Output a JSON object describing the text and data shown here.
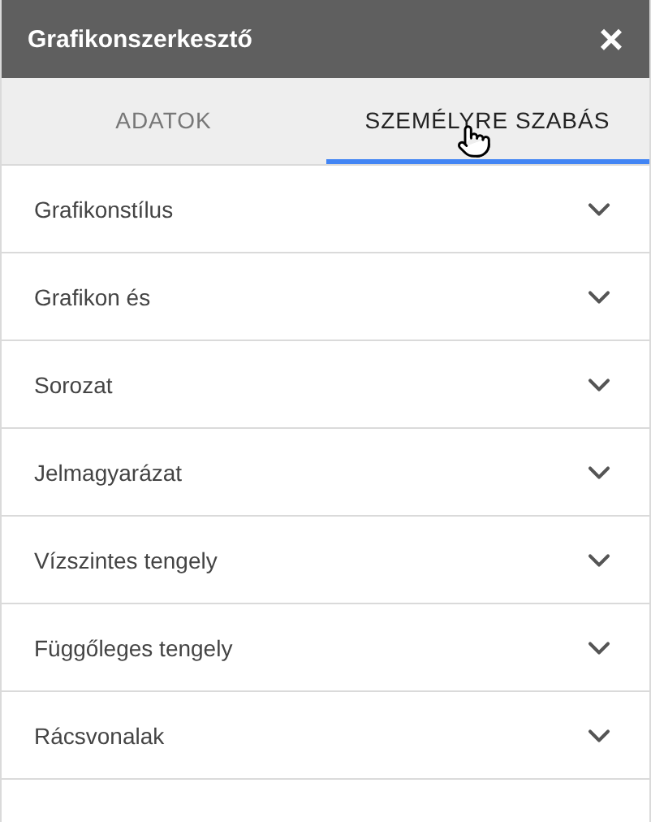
{
  "window": {
    "title": "Grafikonszerkesztő",
    "close": "×"
  },
  "tabs": [
    {
      "label": "ADATOK",
      "selected": false
    },
    {
      "label": "SZEMÉLYRE SZABÁS",
      "selected": true
    }
  ],
  "sections": [
    {
      "label": "Grafikonstílus",
      "expanded": false
    },
    {
      "label": "Grafikon és",
      "expanded": false
    },
    {
      "label": "Sorozat",
      "expanded": false
    },
    {
      "label": "Jelmagyarázat",
      "expanded": false
    },
    {
      "label": "Vízszintes tengely",
      "expanded": false
    },
    {
      "label": "Függőleges tengely",
      "expanded": false
    },
    {
      "label": "Rácsvonalak",
      "expanded": false
    }
  ]
}
